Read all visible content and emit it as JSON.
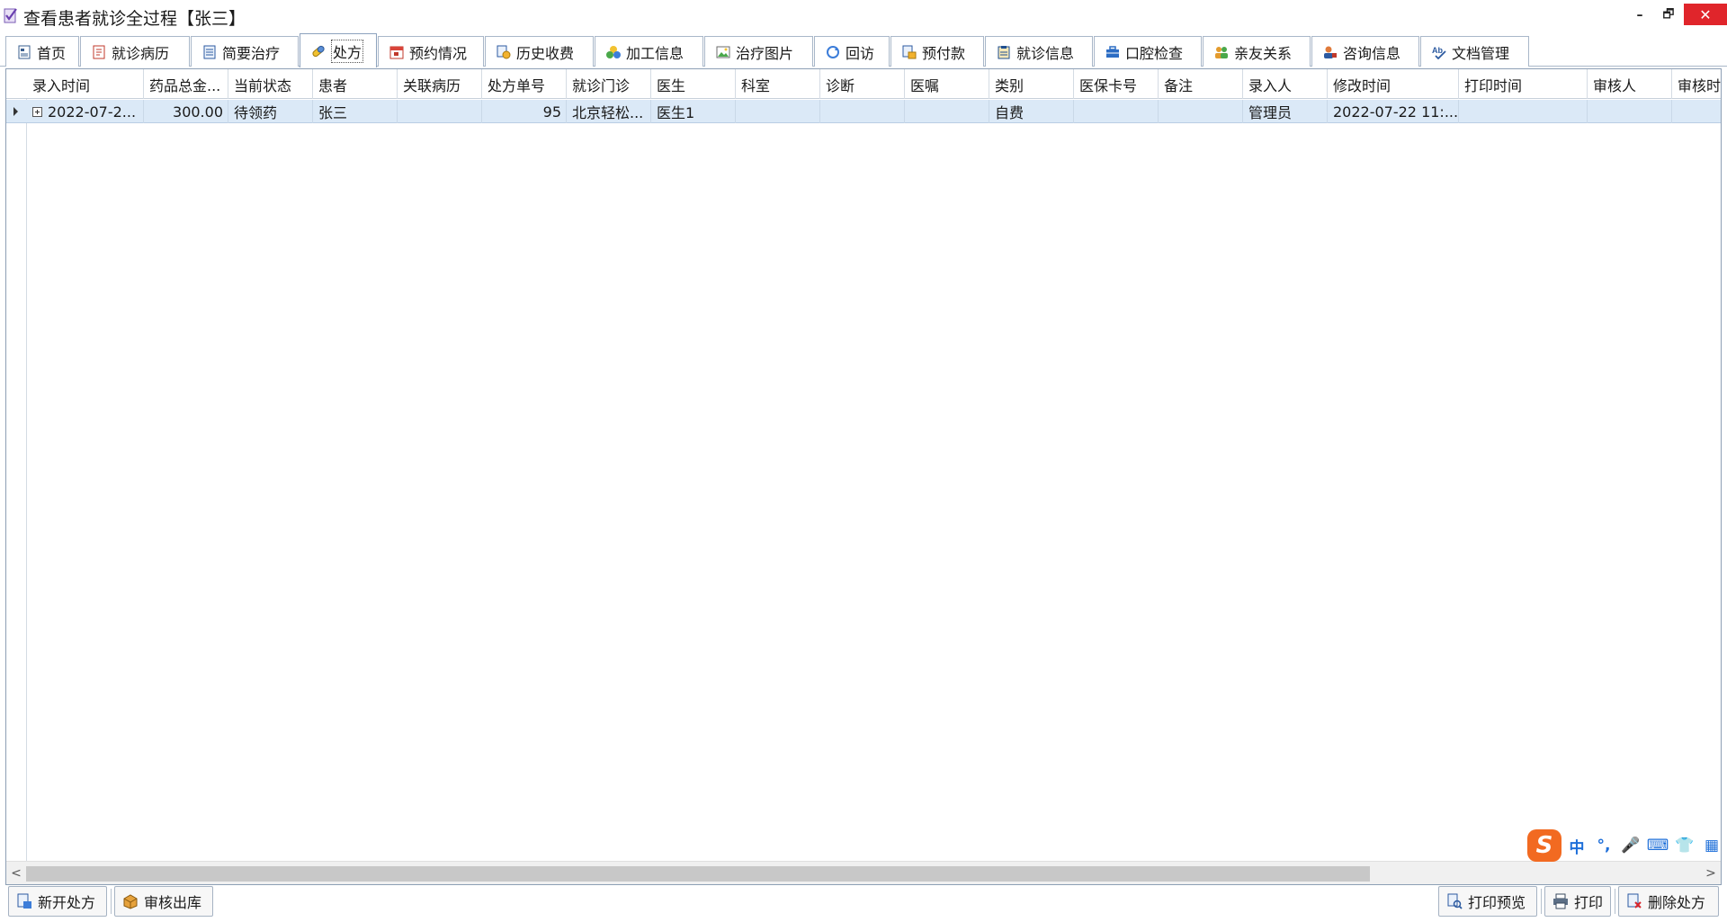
{
  "window": {
    "title": "查看患者就诊全过程【张三】",
    "controls": {
      "minimize": "–",
      "restore": "🗗",
      "close": "✕"
    },
    "close_color": "#e0252b"
  },
  "tabs": [
    {
      "label": "首页",
      "icon": "home-page-icon"
    },
    {
      "label": "就诊病历",
      "icon": "medical-record-icon"
    },
    {
      "label": "简要治疗",
      "icon": "document-icon"
    },
    {
      "label": "处方",
      "icon": "pill-icon",
      "active": true
    },
    {
      "label": "预约情况",
      "icon": "calendar-icon"
    },
    {
      "label": "历史收费",
      "icon": "fee-history-icon"
    },
    {
      "label": "加工信息",
      "icon": "processing-icon"
    },
    {
      "label": "治疗图片",
      "icon": "picture-icon"
    },
    {
      "label": "回访",
      "icon": "refresh-icon"
    },
    {
      "label": "预付款",
      "icon": "prepay-icon"
    },
    {
      "label": "就诊信息",
      "icon": "clipboard-icon"
    },
    {
      "label": "口腔检查",
      "icon": "briefcase-icon"
    },
    {
      "label": "亲友关系",
      "icon": "relatives-icon"
    },
    {
      "label": "咨询信息",
      "icon": "consult-icon"
    },
    {
      "label": "文档管理",
      "icon": "spellcheck-icon"
    }
  ],
  "grid": {
    "columns": [
      "录入时间",
      "药品总金...",
      "当前状态",
      "患者",
      "关联病历",
      "处方单号",
      "就诊门诊",
      "医生",
      "科室",
      "诊断",
      "医嘱",
      "类别",
      "医保卡号",
      "备注",
      "录入人",
      "修改时间",
      "打印时间",
      "审核人",
      "审核时"
    ],
    "rows": [
      [
        "2022-07-2...",
        "300.00",
        "待领药",
        "张三",
        "",
        "95",
        "北京轻松...",
        "医生1",
        "",
        "",
        "",
        "自费",
        "",
        "",
        "管理员",
        "2022-07-22 11:...",
        "",
        "",
        ""
      ]
    ],
    "selected_row_color": "#dbe9f7"
  },
  "scrollbar": {
    "left_arrow": "<",
    "right_arrow": ">"
  },
  "ime_toolbar": {
    "logo": "S",
    "mode": "中",
    "items": [
      "°,",
      "🎤",
      "⌨",
      "👕",
      "▦"
    ]
  },
  "buttons": {
    "new_prescription": "新开处方",
    "review_dispense": "审核出库",
    "print_preview": "打印预览",
    "print": "打印",
    "delete_prescription": "删除处方"
  }
}
